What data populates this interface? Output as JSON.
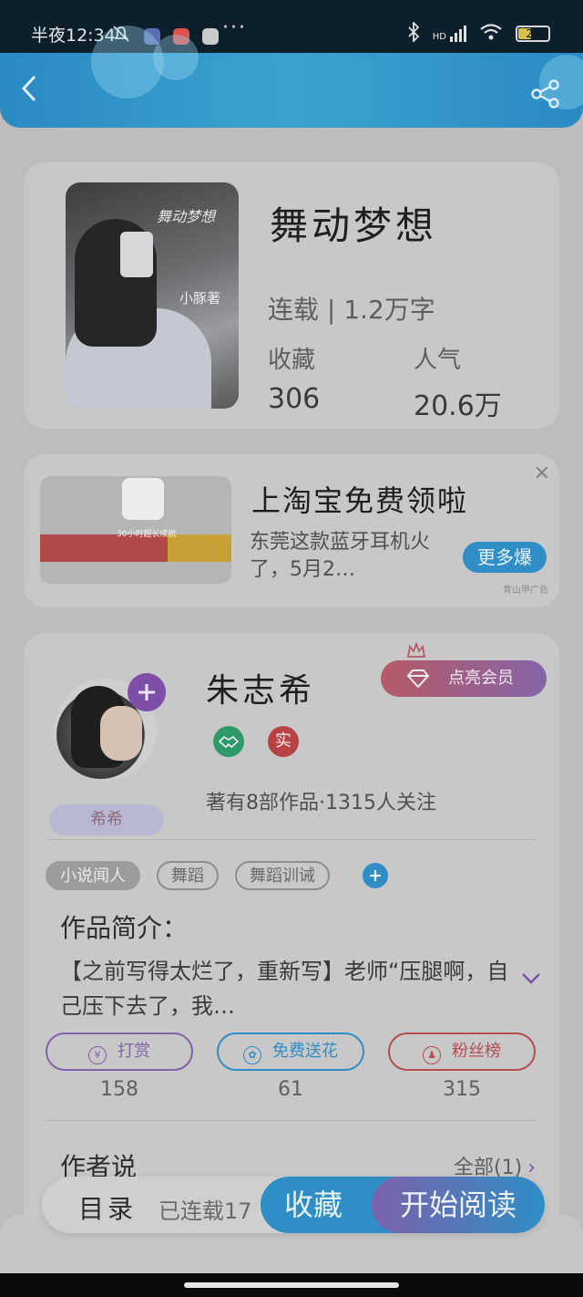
{
  "status_bar": {
    "time": "半夜12:34",
    "more": "···",
    "network": "HD",
    "battery": "23"
  },
  "book": {
    "cover_title": "舞动梦想",
    "cover_author": "小豚著",
    "title": "舞动梦想",
    "serial_status": "连载 | 1.2万字",
    "collect_label": "收藏",
    "collect_value": "306",
    "popularity_label": "人气",
    "popularity_value": "20.6万"
  },
  "ad": {
    "image_text": "30小时超长续航",
    "title": "上淘宝免费领啦",
    "description": "东莞这款蓝牙耳机火了，5月2…",
    "more_button": "更多爆",
    "source": "青山甲广告",
    "close": "×"
  },
  "author": {
    "name": "朱志希",
    "nickname_tag": "希希",
    "member_button": "点亮会员",
    "badge_real": "实",
    "meta": "著有8部作品·1315人关注",
    "tags": [
      "小说闻人",
      "舞蹈",
      "舞蹈训诫"
    ],
    "intro_label": "作品简介：",
    "intro_text": "【之前写得太烂了，重新写】老师“压腿啊，自己压下去了，我…",
    "actions": [
      {
        "label": "打赏",
        "count": "158",
        "icon": "yen-icon"
      },
      {
        "label": "免费送花",
        "count": "61",
        "icon": "flower-icon"
      },
      {
        "label": "粉丝榜",
        "count": "315",
        "icon": "fans-icon"
      }
    ],
    "says_label": "作者说",
    "says_all": "全部(1)"
  },
  "bottom_bar": {
    "toc": "目录",
    "toc_status": "已连载17",
    "collect": "收藏",
    "start_reading": "开始阅读"
  },
  "colors": {
    "accent_blue": "#2f8ec6",
    "accent_purple": "#7d4fa8",
    "accent_red": "#b54d51"
  }
}
